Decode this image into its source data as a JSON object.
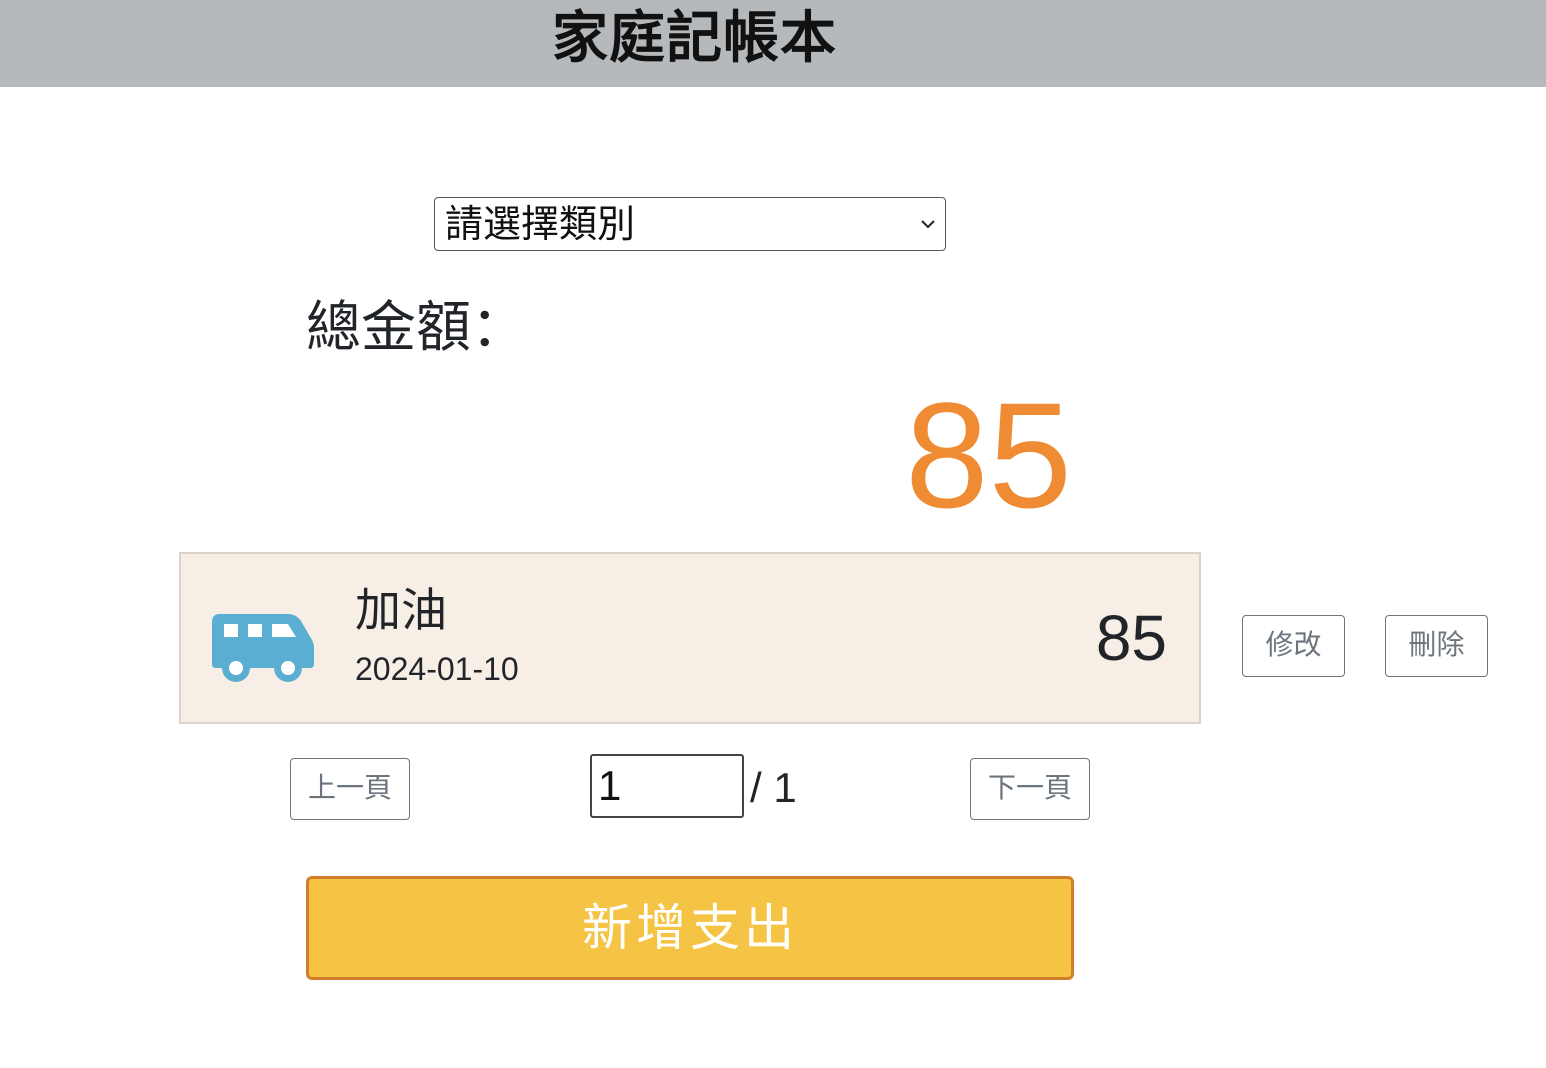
{
  "header": {
    "title": "家庭記帳本"
  },
  "filter": {
    "category_select": "請選擇類別"
  },
  "summary": {
    "total_label": "總金額：",
    "total_amount": "85"
  },
  "records": [
    {
      "icon": "bus-icon",
      "title": "加油",
      "date": "2024-01-10",
      "amount": "85"
    }
  ],
  "actions": {
    "edit_label": "修改",
    "delete_label": "刪除"
  },
  "pagination": {
    "prev_label": "上一頁",
    "current_page": "1",
    "total_pages": "/ 1",
    "next_label": "下一頁"
  },
  "add_button": {
    "label": "新增支出"
  },
  "colors": {
    "header_bg": "#b5b9bc",
    "total_amount": "#ef8c33",
    "card_bg": "#f7eee6",
    "icon": "#5aaed1",
    "add_button_bg": "#f5c445",
    "add_button_border": "#d17e2a"
  }
}
